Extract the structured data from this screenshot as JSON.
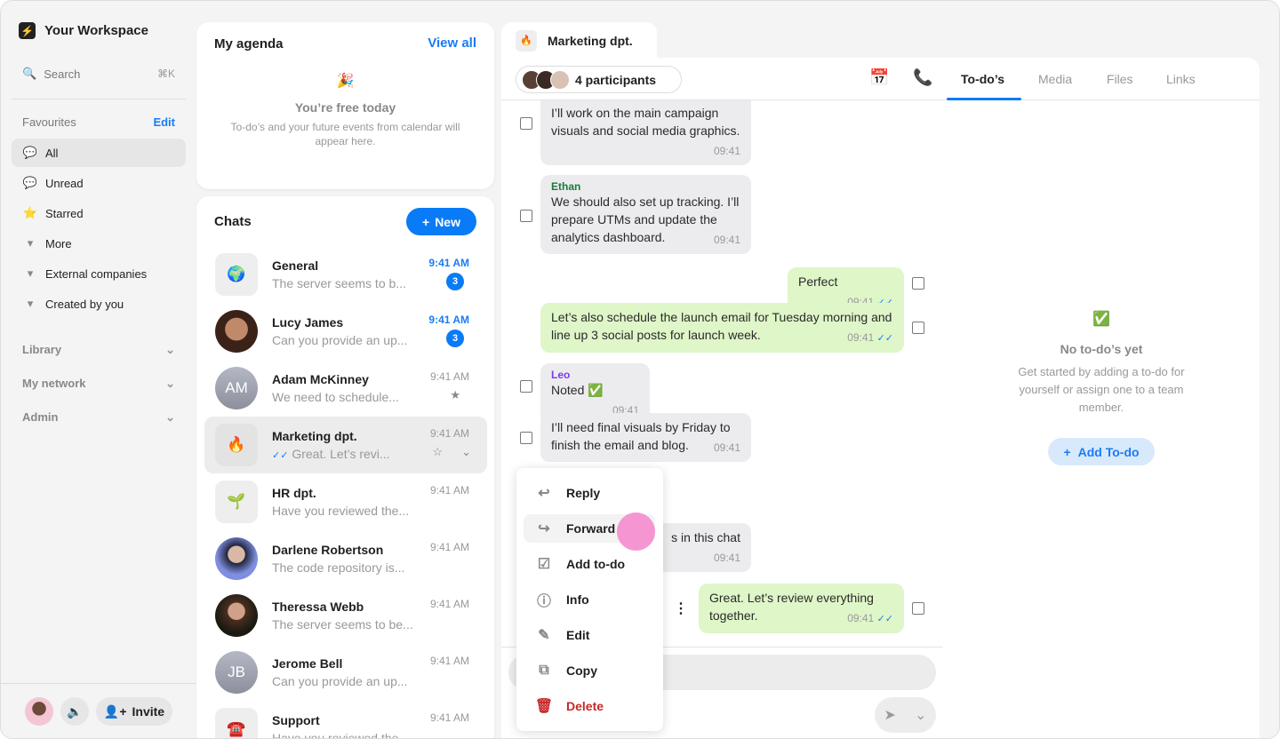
{
  "workspace": {
    "name": "Your Workspace",
    "search_label": "Search",
    "search_shortcut": "⌘K"
  },
  "favourites": {
    "label": "Favourites",
    "edit": "Edit",
    "items": [
      {
        "label": "All",
        "icon": "speech-bubble"
      },
      {
        "label": "Unread",
        "icon": "speech-bubble-dot"
      },
      {
        "label": "Starred",
        "icon": "star"
      },
      {
        "label": "More",
        "icon": "caret-down"
      },
      {
        "label": "External companies",
        "icon": "caret-down"
      },
      {
        "label": "Created by you",
        "icon": "caret-down"
      }
    ]
  },
  "sections": [
    "Library",
    "My network",
    "Admin"
  ],
  "footer": {
    "invite": "Invite"
  },
  "agenda": {
    "title": "My agenda",
    "view_all": "View all",
    "emoji": "🎉",
    "empty_title": "You’re free today",
    "empty_text": "To-do’s and your future events from calendar will appear here."
  },
  "chats": {
    "title": "Chats",
    "new_label": "New",
    "items": [
      {
        "name": "General",
        "preview": "The server seems to b...",
        "time": "9:41 AM",
        "badge": "3",
        "emoji": "🌍"
      },
      {
        "name": "Lucy James",
        "preview": "Can you provide an up...",
        "time": "9:41 AM",
        "badge": "3"
      },
      {
        "name": "Adam McKinney",
        "preview": "We need to schedule...",
        "time": "9:41 AM",
        "initials": "AM"
      },
      {
        "name": "Marketing dpt.",
        "preview": "Great. Let’s revi...",
        "time": "9:41 AM",
        "emoji": "🔥"
      },
      {
        "name": "HR dpt.",
        "preview": "Have you reviewed the...",
        "time": "9:41 AM",
        "emoji": "🌱"
      },
      {
        "name": "Darlene Robertson",
        "preview": "The code repository is...",
        "time": "9:41 AM"
      },
      {
        "name": "Theressa Webb",
        "preview": "The server seems to be...",
        "time": "9:41 AM"
      },
      {
        "name": "Jerome Bell",
        "preview": "Can you provide an up...",
        "time": "9:41 AM",
        "initials": "JB"
      },
      {
        "name": "Support",
        "preview": "Have you reviewed the...",
        "time": "9:41 AM",
        "emoji": "☎️"
      }
    ]
  },
  "conversation": {
    "tab_title": "Marketing dpt.",
    "tab_emoji": "🔥",
    "participants": "4 participants",
    "messages": [
      {
        "text": "I’ll work on the main campaign visuals and social media graphics.",
        "time": "09:41"
      },
      {
        "author": "Ethan",
        "text": "We should also set up tracking. I’ll prepare UTMs and update the analytics dashboard.",
        "time": "09:41"
      },
      {
        "text": "Perfect",
        "time": "09:41",
        "mine": true
      },
      {
        "text": "Let’s also schedule the launch email for Tuesday morning and line up 3 social posts for launch week.",
        "time": "09:41",
        "mine": true
      },
      {
        "author": "Leo",
        "text": "Noted ✅",
        "time": "09:41"
      },
      {
        "text": "I’ll need final visuals by Friday to finish the email and blog.",
        "time": "09:41"
      },
      {
        "text": "s in this chat",
        "time": "09:41"
      },
      {
        "text": "Great. Let’s review everything together.",
        "time": "09:41",
        "mine": true
      }
    ],
    "colors": {
      "ethan": "#1a7a3c",
      "leo": "#7c3aed"
    }
  },
  "context_menu": [
    "Reply",
    "Forward",
    "Add to-do",
    "Info",
    "Edit",
    "Copy",
    "Delete"
  ],
  "right_panel": {
    "tabs": [
      "To-do’s",
      "Media",
      "Files",
      "Links"
    ],
    "emoji": "✅",
    "empty_title": "No to-do’s yet",
    "empty_text": "Get started by adding a to-do for yourself or assign one to a team member.",
    "add_label": "Add To-do"
  }
}
